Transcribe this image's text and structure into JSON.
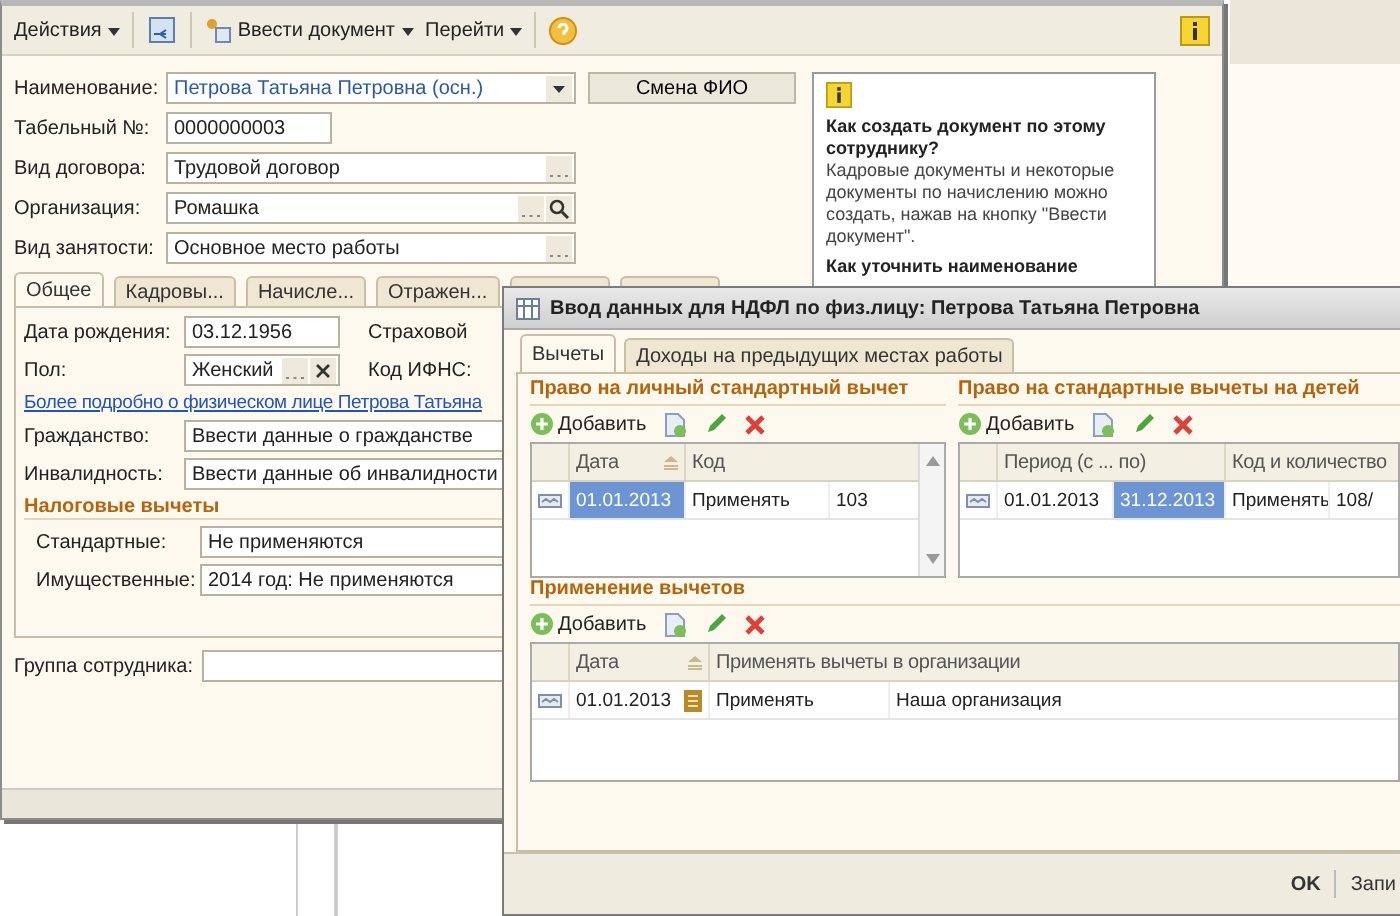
{
  "main_window": {
    "toolbar": {
      "actions_menu": "Действия",
      "enter_document_menu": "Ввести документ",
      "goto_menu": "Перейти"
    },
    "fields": [
      {
        "kind": "dropdown",
        "label": "Наименование:",
        "value": "Петрова Татьяна Петровна  (осн.)"
      },
      {
        "kind": "short",
        "label": "Табельный №:",
        "value": "0000000003"
      },
      {
        "kind": "select",
        "label": "Вид договора:",
        "value": "Трудовой договор"
      },
      {
        "kind": "search",
        "label": "Организация:",
        "value": "Ромашка"
      },
      {
        "kind": "select",
        "label": "Вид занятости:",
        "value": "Основное место работы"
      }
    ],
    "rename_button": "Смена ФИО",
    "help": [
      {
        "heading": "Как создать документ по этому сотруднику?",
        "text": "Кадровые документы и некоторые документы по начислению можно создать, нажав на кнопку \"Ввести документ\"."
      },
      {
        "heading": "Как уточнить наименование"
      }
    ],
    "tabs": [
      {
        "label": "Общее",
        "selected": true
      },
      {
        "label": "Кадровы...",
        "selected": false
      },
      {
        "label": "Начисле...",
        "selected": false
      },
      {
        "label": "Отражен...",
        "selected": false
      },
      {
        "selected": false
      },
      {
        "selected": false
      }
    ],
    "general": {
      "birth_date_label": "Дата рождения:",
      "birth_date": "03.12.1956",
      "gender_label": "Пол:",
      "gender": "Женский",
      "insurance_label": "Страховой",
      "ifns_label": "Код ИФНС:",
      "details_link": "Более подробно о физическом лице Петрова Татьяна",
      "citizenship_label": "Гражданство:",
      "citizenship": "Ввести данные о гражданстве",
      "disability_label": "Инвалидность:",
      "disability": "Ввести данные об инвалидности",
      "tax_section": "Налоговые вычеты",
      "standard_label": "Стандартные:",
      "standard": "Не применяются",
      "property_label": "Имущественные:",
      "property": "2014 год: Не применяются"
    },
    "group_label": "Группа сотрудника:"
  },
  "dialog": {
    "title": "Ввод данных для НДФЛ по физ.лицу: Петрова Татьяна Петровна",
    "tabs": [
      {
        "label": "Вычеты",
        "selected": true
      },
      {
        "label": "Доходы на предыдущих местах работы",
        "selected": false
      }
    ],
    "personal": {
      "title": "Право на личный стандартный вычет",
      "add": "Добавить",
      "columns": [
        "Дата",
        "Код",
        ""
      ],
      "rows": [
        {
          "cells": [
            {
              "text": "01.01.2013",
              "selected": true
            },
            {
              "text": "Применять",
              "selected": false
            },
            {
              "text": "103",
              "selected": false
            }
          ]
        }
      ]
    },
    "children": {
      "title": "Право на стандартные вычеты на детей",
      "add": "Добавить",
      "columns": [
        "Период (с ... по)",
        "",
        "Код и количество",
        ""
      ],
      "rows": [
        {
          "cells": [
            {
              "text": "01.01.2013",
              "selected": false
            },
            {
              "text": "31.12.2013",
              "selected": true
            },
            {
              "text": "Применять",
              "selected": false
            },
            {
              "text": "108/",
              "selected": false
            }
          ]
        }
      ]
    },
    "application": {
      "title": "Применение вычетов",
      "add": "Добавить",
      "columns": [
        "Дата",
        "Применять вычеты в организации",
        ""
      ],
      "rows": [
        {
          "cells": [
            {
              "text": "01.01.2013",
              "selected": false
            },
            {
              "text": "Применять",
              "selected": false
            },
            {
              "text": "Наша организация",
              "selected": false
            }
          ]
        }
      ]
    },
    "buttons": [
      "OK",
      "Запи"
    ]
  }
}
